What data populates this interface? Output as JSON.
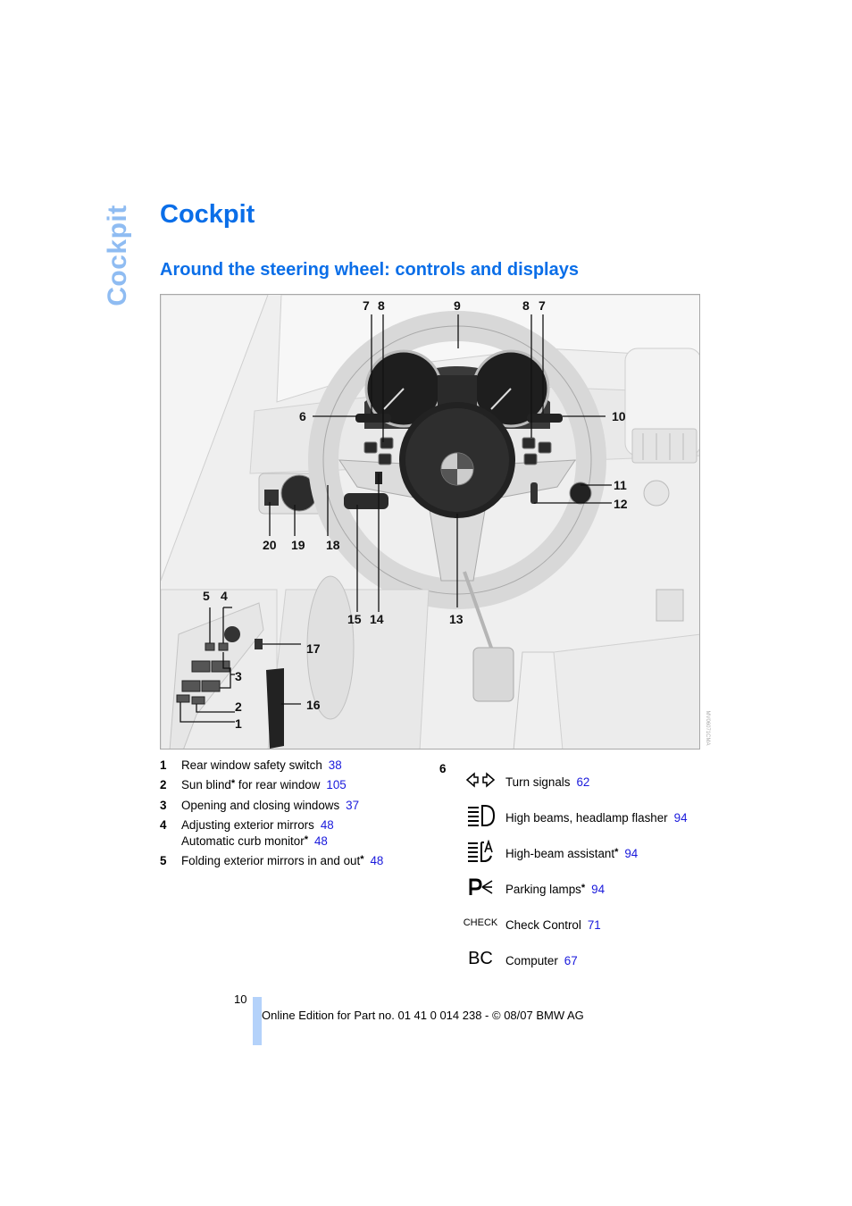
{
  "side_tab": "Cockpit",
  "page_title": "Cockpit",
  "section_title": "Around the steering wheel: controls and displays",
  "figure": {
    "image_code": "MV06071CMA",
    "callouts": [
      "1",
      "2",
      "3",
      "4",
      "5",
      "6",
      "7",
      "8",
      "9",
      "8",
      "7",
      "10",
      "11",
      "12",
      "13",
      "14",
      "15",
      "16",
      "17",
      "18",
      "19",
      "20"
    ]
  },
  "legend_left": [
    {
      "num": "1",
      "text": "Rear window safety switch",
      "star": false,
      "ref": "38"
    },
    {
      "num": "2",
      "text": "Sun blind",
      "star": true,
      "text_after": " for rear window",
      "ref": "105"
    },
    {
      "num": "3",
      "text": "Opening and closing windows",
      "star": false,
      "ref": "37"
    },
    {
      "num": "4",
      "text": "Adjusting exterior mirrors",
      "star": false,
      "ref": "48",
      "line2": {
        "text": "Automatic curb monitor",
        "star": true,
        "ref": "48"
      }
    },
    {
      "num": "5",
      "text": "Folding exterior mirrors in and out",
      "star": true,
      "ref": "48"
    }
  ],
  "legend_right": {
    "num": "6",
    "items": [
      {
        "icon": "turn-signal-icon",
        "text": "Turn signals",
        "star": false,
        "ref": "62"
      },
      {
        "icon": "high-beam-icon",
        "text": "High beams, headlamp flasher",
        "star": false,
        "ref": "94"
      },
      {
        "icon": "high-beam-assistant-icon",
        "text": "High-beam assistant",
        "star": true,
        "ref": "94"
      },
      {
        "icon": "parking-lamps-icon",
        "text": "Parking lamps",
        "star": true,
        "ref": "94"
      },
      {
        "icon": "check-control-icon",
        "icon_text": "CHECK",
        "text": "Check Control",
        "star": false,
        "ref": "71"
      },
      {
        "icon": "computer-icon",
        "icon_text": "BC",
        "text": "Computer",
        "star": false,
        "ref": "67"
      }
    ]
  },
  "star_symbol": "*",
  "footer": {
    "page_number": "10",
    "text": "Online Edition for Part no. 01 41 0 014 238 - © 08/07 BMW AG"
  }
}
